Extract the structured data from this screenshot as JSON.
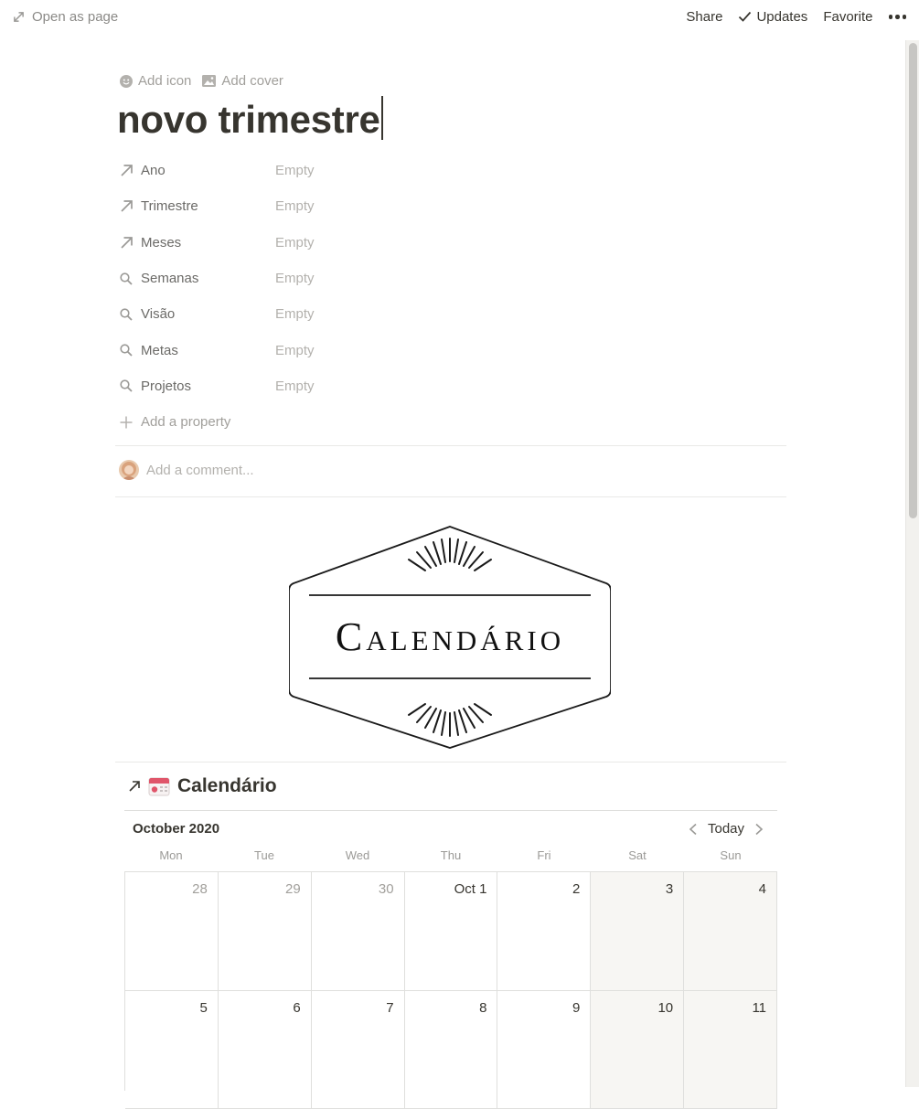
{
  "topbar": {
    "open_as_page": "Open as page",
    "share": "Share",
    "updates": "Updates",
    "favorite": "Favorite"
  },
  "page": {
    "add_icon": "Add icon",
    "add_cover": "Add cover",
    "title": "novo trimestre"
  },
  "properties": [
    {
      "name": "Ano",
      "value": "Empty",
      "icon": "arrow-up-right-icon"
    },
    {
      "name": "Trimestre",
      "value": "Empty",
      "icon": "arrow-up-right-icon"
    },
    {
      "name": "Meses",
      "value": "Empty",
      "icon": "arrow-up-right-icon"
    },
    {
      "name": "Semanas",
      "value": "Empty",
      "icon": "search-icon"
    },
    {
      "name": "Visão",
      "value": "Empty",
      "icon": "search-icon"
    },
    {
      "name": "Metas",
      "value": "Empty",
      "icon": "search-icon"
    },
    {
      "name": "Projetos",
      "value": "Empty",
      "icon": "search-icon"
    }
  ],
  "add_property": "Add a property",
  "comment": {
    "placeholder": "Add a comment..."
  },
  "banner": {
    "text": "Calendário"
  },
  "database": {
    "title": "Calendário",
    "month": "October 2020",
    "today": "Today",
    "weekdays": [
      "Mon",
      "Tue",
      "Wed",
      "Thu",
      "Fri",
      "Sat",
      "Sun"
    ],
    "weeks": [
      [
        "28",
        "29",
        "30",
        "Oct 1",
        "2",
        "3",
        "4"
      ],
      [
        "5",
        "6",
        "7",
        "8",
        "9",
        "10",
        "11"
      ]
    ]
  },
  "colors": {
    "text": "#37352f",
    "muted": "#a19f9b",
    "weekend_bg": "#f7f6f3",
    "border": "#dfdfdd"
  }
}
